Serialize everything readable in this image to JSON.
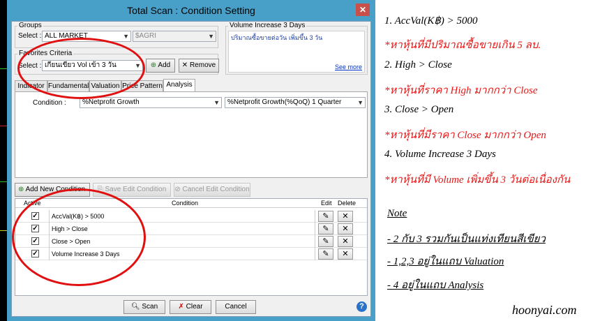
{
  "window": {
    "title": "Total Scan : Condition Setting",
    "close_glyph": "✕"
  },
  "groups": {
    "label": "Groups",
    "select_label": "Select :",
    "market_value": "ALL MARKET",
    "sector_value": "$AGRI"
  },
  "favorites": {
    "label": "Favorites Criteria",
    "select_label": "Select :",
    "value": "เกียนเขียว Vol เข้า 3 วัน",
    "add_label": "Add",
    "remove_label": "Remove"
  },
  "description": {
    "label": "Volume Increase 3 Days",
    "text": "ปริมาณซื้อขายต่อวัน เพิ่มขึ้น 3 วัน",
    "see_more": "See more"
  },
  "tabs": [
    {
      "label": "Indicator"
    },
    {
      "label": "Fundamental"
    },
    {
      "label": "Valuation"
    },
    {
      "label": "Price Pattern"
    },
    {
      "label": "Analysis"
    }
  ],
  "condition": {
    "label": "Condition :",
    "value1": "%Netprofit Growth",
    "value2": "%Netprofit Growth(%QoQ) 1 Quarter"
  },
  "actions": {
    "add_new": "Add New Condition",
    "save_edit": "Save Edit Condition",
    "cancel_edit": "Cancel Edit Condition"
  },
  "grid": {
    "headers": {
      "active": "Active",
      "condition": "Condition",
      "edit": "Edit",
      "delete": "Delete"
    },
    "rows": [
      {
        "active": true,
        "condition": "AccVal(K฿) > 5000"
      },
      {
        "active": true,
        "condition": "High > Close"
      },
      {
        "active": true,
        "condition": "Close > Open"
      },
      {
        "active": true,
        "condition": "Volume Increase 3 Days"
      }
    ]
  },
  "footer": {
    "scan": "Scan",
    "clear": "Clear",
    "cancel": "Cancel",
    "help": "?"
  },
  "notes": {
    "line1": "1. AccVal(K฿) > 5000",
    "line1_th": "*หาหุ้นที่มีปริมาณซื้อขายเกิน 5 ลบ.",
    "line2": "2. High > Close",
    "line2_th": "*หาหุ้นที่ราคา High มากกว่า Close",
    "line3": "3. Close > Open",
    "line3_th": "*หาหุ้นที่มีราคา Close มากกว่า Open",
    "line4": "4. Volume Increase 3 Days",
    "line4_th": "*หาหุ้นที่มี Volume เพิ่มขึ้น 3 วันต่อเนื่องกัน",
    "note_title": "Note",
    "note1": "- 2 กับ 3 รวมกันเป็นแท่งเทียนสีเขียว",
    "note2": "- 1,2,3 อยู่ในแถบ Valuation",
    "note3": "- 4 อยู่ในแถบ Analysis",
    "site": "hoonyai.com"
  },
  "colors": {
    "window_frame": "#48a0c8",
    "annotation_red": "#e01010",
    "link_blue": "#0033cc"
  }
}
